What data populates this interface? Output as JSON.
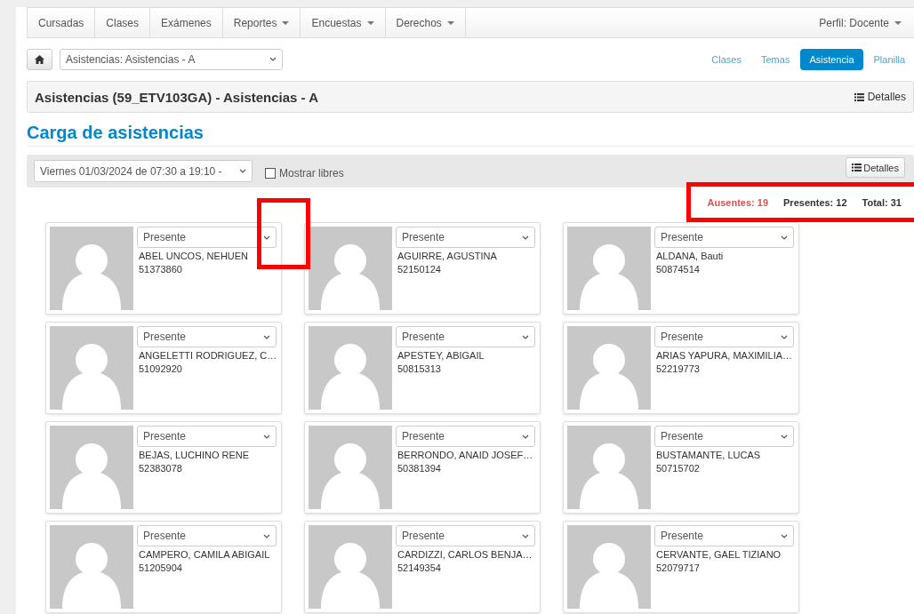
{
  "navbar": {
    "items": [
      {
        "label": "Cursadas",
        "dropdown": false
      },
      {
        "label": "Clases",
        "dropdown": false
      },
      {
        "label": "Exámenes",
        "dropdown": false
      },
      {
        "label": "Reportes",
        "dropdown": true
      },
      {
        "label": "Encuestas",
        "dropdown": true
      },
      {
        "label": "Derechos",
        "dropdown": true
      }
    ],
    "profile": "Perfil: Docente"
  },
  "breadcrumb": {
    "select": "Asistencias: Asistencias - A"
  },
  "pills": [
    {
      "label": "Clases",
      "selected": false
    },
    {
      "label": "Temas",
      "selected": false
    },
    {
      "label": "Asistencia",
      "selected": true
    },
    {
      "label": "Planilla",
      "selected": false
    }
  ],
  "panel": {
    "title": "Asistencias (59_ETV103GA) - Asistencias - A",
    "button": "Detalles"
  },
  "heading": "Carga de asistencias",
  "toolbar": {
    "date_select": "Viernes 01/03/2024 de 07:30 a 19:10 -",
    "checkbox": {
      "label": "Mostrar libres",
      "checked": false
    },
    "button": "Detalles"
  },
  "summary": [
    {
      "label": "Ausentes: 19",
      "kind": "absent"
    },
    {
      "label": "Presentes: 12",
      "kind": "present"
    },
    {
      "label": "Total: 31",
      "kind": "total"
    }
  ],
  "students": [
    {
      "status": "Presente",
      "name": "ABEL UNCOS, NEHUEN",
      "id": "51373860"
    },
    {
      "status": "Presente",
      "name": "AGUIRRE, AGUSTINA",
      "id": "52150124"
    },
    {
      "status": "Presente",
      "name": "ALDANA, Bauti",
      "id": "50874514"
    },
    {
      "status": "Presente",
      "name": "ANGELETTI RODRIGUEZ, C…",
      "id": "51092920"
    },
    {
      "status": "Presente",
      "name": "APESTEY, ABIGAIL",
      "id": "50815313"
    },
    {
      "status": "Presente",
      "name": "ARIAS YAPURA, MAXIMILIA…",
      "id": "52219773"
    },
    {
      "status": "Presente",
      "name": "BEJAS, LUCHINO RENE",
      "id": "52383078"
    },
    {
      "status": "Presente",
      "name": "BERRONDO, ANAID JOSEF…",
      "id": "50381394"
    },
    {
      "status": "Presente",
      "name": "BUSTAMANTE, LUCAS",
      "id": "50715702"
    },
    {
      "status": "Presente",
      "name": "CAMPERO, CAMILA ABIGAIL",
      "id": "51205904"
    },
    {
      "status": "Presente",
      "name": "CARDIZZI, CARLOS BENJA…",
      "id": "52149354"
    },
    {
      "status": "Presente",
      "name": "CERVANTE, GAEL TIZIANO",
      "id": "52079717"
    }
  ]
}
